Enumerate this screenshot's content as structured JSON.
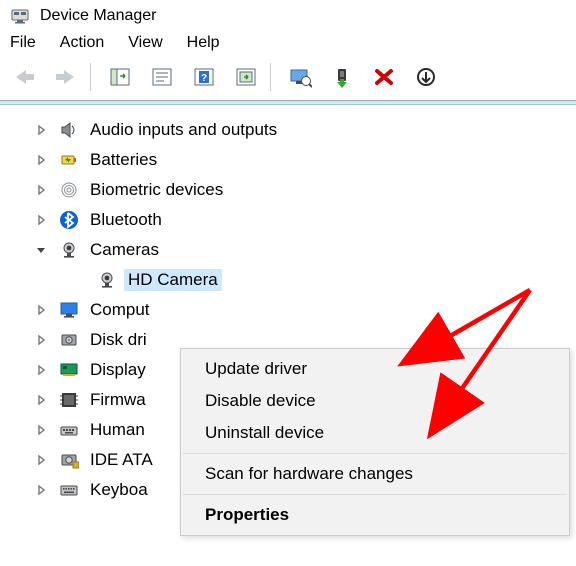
{
  "window": {
    "title": "Device Manager"
  },
  "menubar": {
    "items": [
      "File",
      "Action",
      "View",
      "Help"
    ]
  },
  "tree": {
    "nodes": [
      {
        "label": "Audio inputs and outputs",
        "expanded": false,
        "icon": "speaker"
      },
      {
        "label": "Batteries",
        "expanded": false,
        "icon": "battery"
      },
      {
        "label": "Biometric devices",
        "expanded": false,
        "icon": "fingerprint"
      },
      {
        "label": "Bluetooth",
        "expanded": false,
        "icon": "bluetooth"
      },
      {
        "label": "Cameras",
        "expanded": true,
        "icon": "camera",
        "children": [
          {
            "label": "HD Camera",
            "selected": true
          }
        ]
      },
      {
        "label": "Comput",
        "expanded": false,
        "icon": "monitor"
      },
      {
        "label": "Disk dri",
        "expanded": false,
        "icon": "disk"
      },
      {
        "label": "Display",
        "expanded": false,
        "icon": "display-adapter"
      },
      {
        "label": "Firmwa",
        "expanded": false,
        "icon": "firmware"
      },
      {
        "label": "Human",
        "expanded": false,
        "icon": "hid"
      },
      {
        "label": "IDE ATA",
        "expanded": false,
        "icon": "ide"
      },
      {
        "label": "Keyboa",
        "expanded": false,
        "icon": "keyboard"
      }
    ]
  },
  "context_menu": {
    "items": [
      {
        "label": "Update driver"
      },
      {
        "label": "Disable device"
      },
      {
        "label": "Uninstall device"
      },
      {
        "sep": true
      },
      {
        "label": "Scan for hardware changes"
      },
      {
        "sep": true
      },
      {
        "label": "Properties",
        "bold": true
      }
    ]
  }
}
